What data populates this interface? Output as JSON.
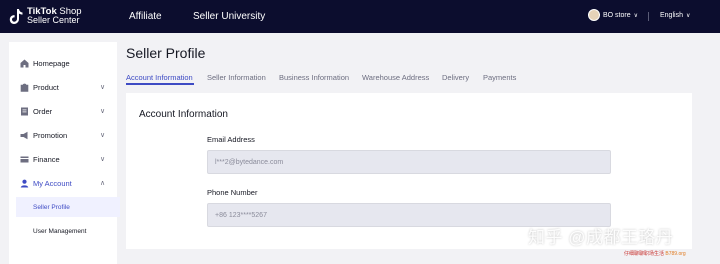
{
  "header": {
    "logo_line1_bold": "TikTok",
    "logo_line1_thin": " Shop",
    "logo_line2": "Seller Center",
    "nav": [
      "Affiliate",
      "Seller University"
    ],
    "store_name": "BO store",
    "language": "English",
    "background": "#0c0d2e"
  },
  "sidebar": {
    "items": [
      {
        "label": "Homepage",
        "icon": "home-icon",
        "chevron": ""
      },
      {
        "label": "Product",
        "icon": "product-icon",
        "chevron": "∨"
      },
      {
        "label": "Order",
        "icon": "order-icon",
        "chevron": "∨"
      },
      {
        "label": "Promotion",
        "icon": "promotion-icon",
        "chevron": "∨"
      },
      {
        "label": "Finance",
        "icon": "finance-icon",
        "chevron": "∨"
      },
      {
        "label": "My Account",
        "icon": "account-icon",
        "chevron": "∧"
      }
    ],
    "subitems": [
      "Seller Profile",
      "User Management"
    ],
    "accent": "#3e4bc4"
  },
  "main": {
    "title": "Seller Profile",
    "tabs": [
      "Account Information",
      "Seller Information",
      "Business Information",
      "Warehouse Address",
      "Delivery",
      "Payments"
    ],
    "card": {
      "title": "Account Information",
      "email_label": "Email Address",
      "email_value": "l***2@bytedance.com",
      "phone_label": "Phone Number",
      "phone_value": "+86 123****5267"
    }
  },
  "watermark": {
    "main": "知乎 @成都王珞丹",
    "sub_red": "仔细聊聊职场生活",
    "sub_orange": "B789.org"
  }
}
